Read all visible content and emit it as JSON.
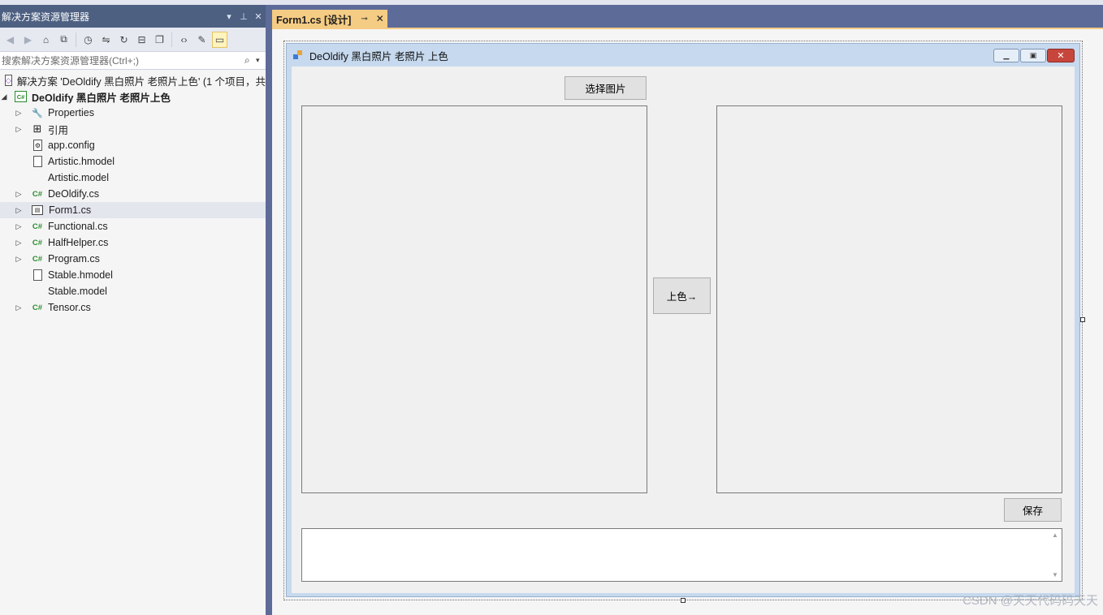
{
  "solution_explorer": {
    "title": "解决方案资源管理器",
    "title_buttons": [
      "▾",
      "⊥",
      "✕"
    ],
    "search_placeholder": "搜索解决方案资源管理器(Ctrl+;)",
    "solution_label": "解决方案 'DeOldify 黑白照片 老照片上色' (1 个项目，共",
    "project_label": "DeOldify 黑白照片 老照片上色",
    "items": [
      {
        "label": "Properties",
        "icon": "wrench-icon",
        "expandable": true
      },
      {
        "label": "引用",
        "icon": "references-icon",
        "expandable": true
      },
      {
        "label": "app.config",
        "icon": "config-icon",
        "expandable": false
      },
      {
        "label": "Artistic.hmodel",
        "icon": "file-icon",
        "expandable": false
      },
      {
        "label": "Artistic.model",
        "icon": "",
        "expandable": false
      },
      {
        "label": "DeOldify.cs",
        "icon": "csharp-icon",
        "expandable": true
      },
      {
        "label": "Form1.cs",
        "icon": "form-icon",
        "expandable": true,
        "selected": true
      },
      {
        "label": "Functional.cs",
        "icon": "csharp-icon",
        "expandable": true
      },
      {
        "label": "HalfHelper.cs",
        "icon": "csharp-icon",
        "expandable": true
      },
      {
        "label": "Program.cs",
        "icon": "csharp-icon",
        "expandable": true
      },
      {
        "label": "Stable.hmodel",
        "icon": "file-icon",
        "expandable": false
      },
      {
        "label": "Stable.model",
        "icon": "",
        "expandable": false
      },
      {
        "label": "Tensor.cs",
        "icon": "csharp-icon",
        "expandable": true
      }
    ]
  },
  "document_tab": {
    "label": "Form1.cs [设计]",
    "pin": "⊸",
    "close": "✕"
  },
  "form": {
    "title": "DeOldify 黑白照片 老照片 上色",
    "select_button": "选择图片",
    "colorize_button": "上色→",
    "save_button": "保存",
    "scroll_up": "▲",
    "scroll_down": "▼"
  },
  "watermark": "CSDN @天天代码码天天",
  "colors": {
    "accent_tab": "#f5cc84",
    "panel_title": "#4d6082",
    "chrome": "#5d6b99"
  }
}
